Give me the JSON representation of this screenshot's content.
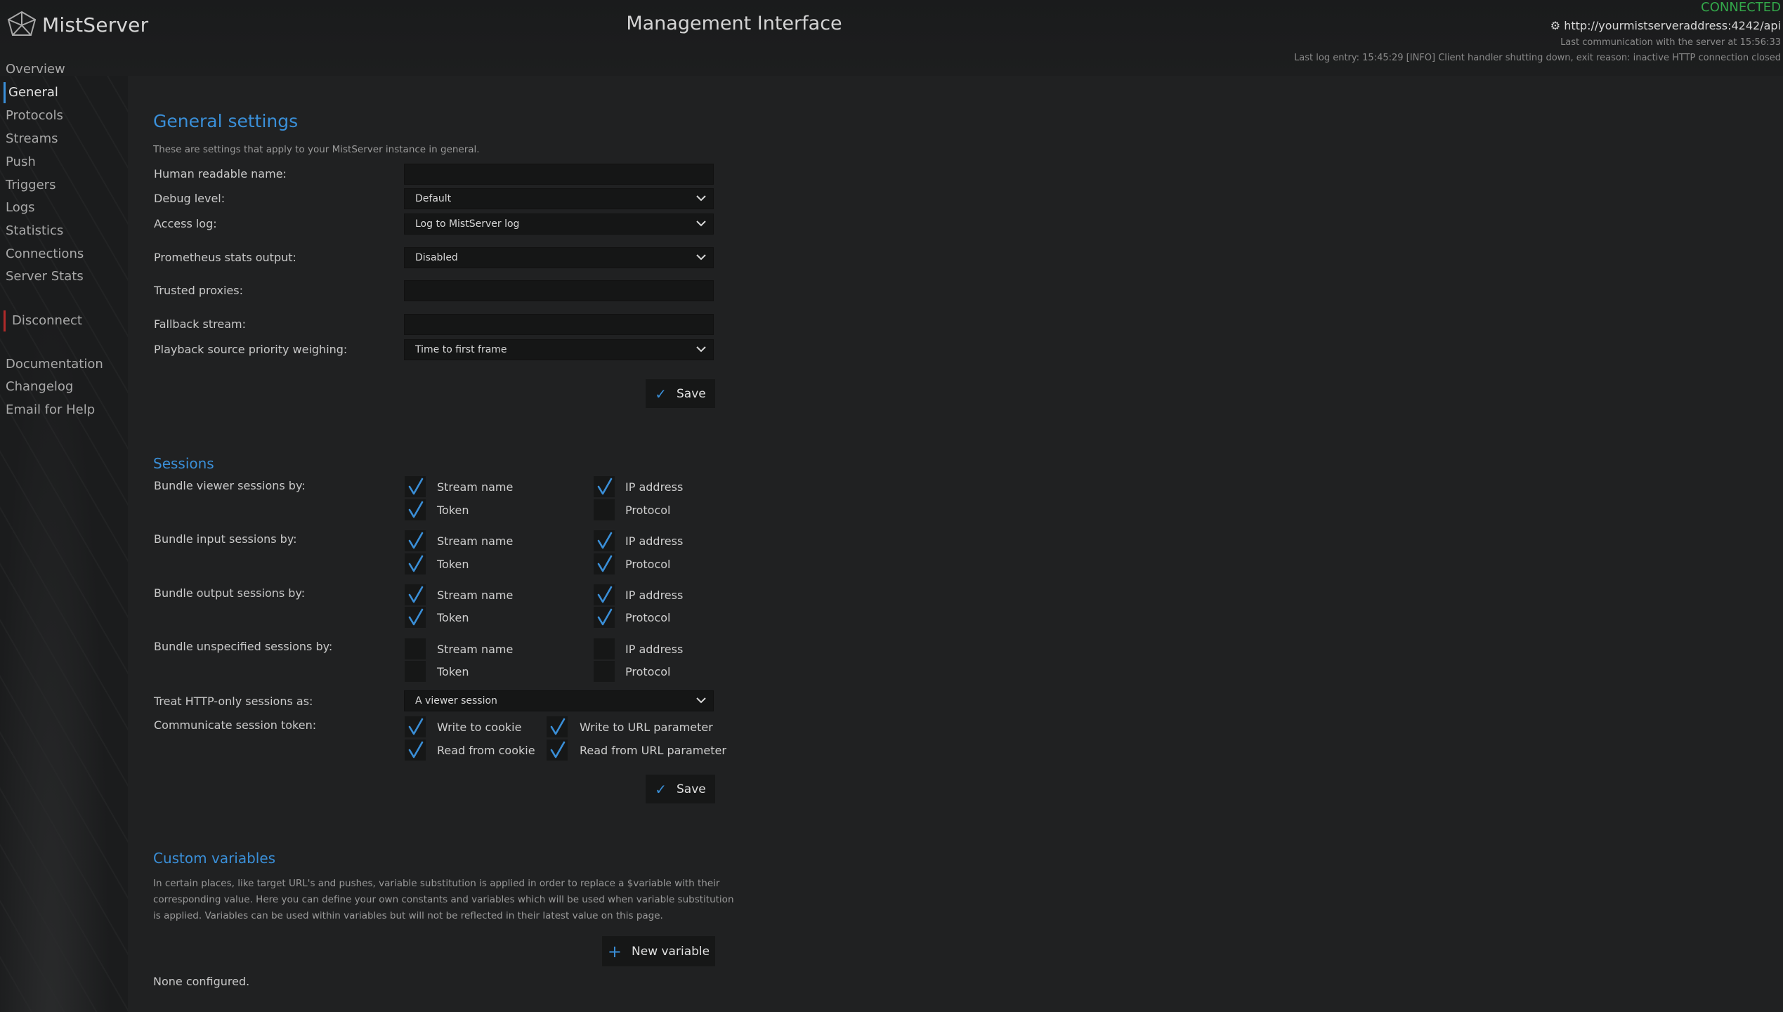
{
  "app": {
    "name": "MistServer",
    "title": "Management Interface"
  },
  "status": {
    "connected": "CONNECTED",
    "server": "⚙ http://yourmistserveraddress:4242/api",
    "last_comm": "Last communication with the server at 15:56:33",
    "last_log": "Last log entry: 15:45:29 [INFO] Client handler shutting down, exit reason: inactive HTTP connection closed"
  },
  "nav": {
    "overview": "Overview",
    "general": "General",
    "protocols": "Protocols",
    "streams": "Streams",
    "push": "Push",
    "triggers": "Triggers",
    "logs": "Logs",
    "statistics": "Statistics",
    "connections": "Connections",
    "server_stats": "Server Stats",
    "disconnect": "Disconnect",
    "documentation": "Documentation",
    "changelog": "Changelog",
    "email": "Email for Help"
  },
  "general": {
    "title": "General settings",
    "description": "These are settings that apply to your MistServer instance in general.",
    "human_name_label": "Human readable name:",
    "human_name_value": "",
    "debug_label": "Debug level:",
    "debug_value": "Default",
    "access_log_label": "Access log:",
    "access_log_value": "Log to MistServer log",
    "prometheus_label": "Prometheus stats output:",
    "prometheus_value": "Disabled",
    "trusted_label": "Trusted proxies:",
    "trusted_value": "",
    "fallback_label": "Fallback stream:",
    "fallback_value": "",
    "playback_label": "Playback source priority weighing:",
    "playback_value": "Time to first frame",
    "save": "Save"
  },
  "sessions": {
    "title": "Sessions",
    "viewer_label": "Bundle viewer sessions by:",
    "input_label": "Bundle input sessions by:",
    "output_label": "Bundle output sessions by:",
    "unspecified_label": "Bundle unspecified sessions by:",
    "opt_stream": "Stream name",
    "opt_ip": "IP address",
    "opt_token": "Token",
    "opt_protocol": "Protocol",
    "http_label": "Treat HTTP-only sessions as:",
    "http_value": "A viewer session",
    "token_label": "Communicate session token:",
    "write_cookie": "Write to cookie",
    "write_url": "Write to URL parameter",
    "read_cookie": "Read from cookie",
    "read_url": "Read from URL parameter",
    "save": "Save"
  },
  "custom": {
    "title": "Custom variables",
    "line1": "In certain places, like target URL's and pushes, variable substitution is applied in order to replace a $variable with their",
    "line2": "corresponding value. Here you can define your own constants and variables which will be used when variable substitution",
    "line3": "is applied. Variables can be used within variables but will not be reflected in their latest value on this page.",
    "new_button": "New variable",
    "none": "None configured."
  },
  "colors": {
    "accent": "#3a8fd8",
    "connected": "#33a84a",
    "danger": "#b02a2a"
  }
}
